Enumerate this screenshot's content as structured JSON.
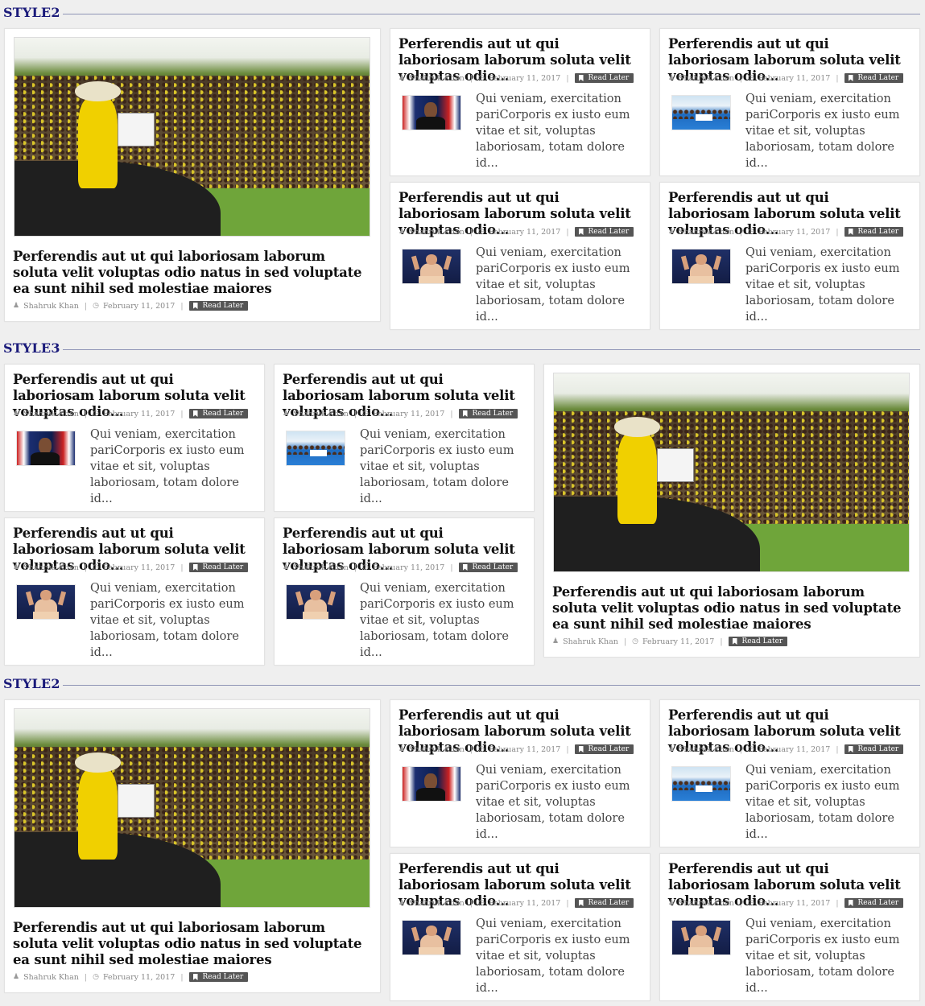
{
  "common": {
    "small_title": "Perferendis aut ut qui laboriosam laborum soluta velit voluptas odio...",
    "big_title": "Perferendis aut ut qui laboriosam laborum soluta velit voluptas odio natus in sed voluptate ea sunt nihil sed molestiae maiores",
    "author": "Shahruk Khan",
    "date": "February 11, 2017",
    "read_later": "Read Later",
    "excerpt": "Qui veniam, exercitation pariCorporis ex iusto eum vitae et sit, voluptas laboriosam, totam dolore id..."
  },
  "sections": [
    {
      "label": "STYLE2"
    },
    {
      "label": "STYLE3"
    },
    {
      "label": "STYLE2"
    }
  ],
  "icons": {
    "author": "user-icon",
    "date": "clock-icon",
    "read_later": "bookmark-icon"
  },
  "thumbs": [
    "obama-photo",
    "team-photo",
    "speaker-photo",
    "speaker-photo"
  ],
  "colors": {
    "section_title": "#1a1a7a",
    "read_later_bg": "#555555",
    "background": "#efefef"
  }
}
